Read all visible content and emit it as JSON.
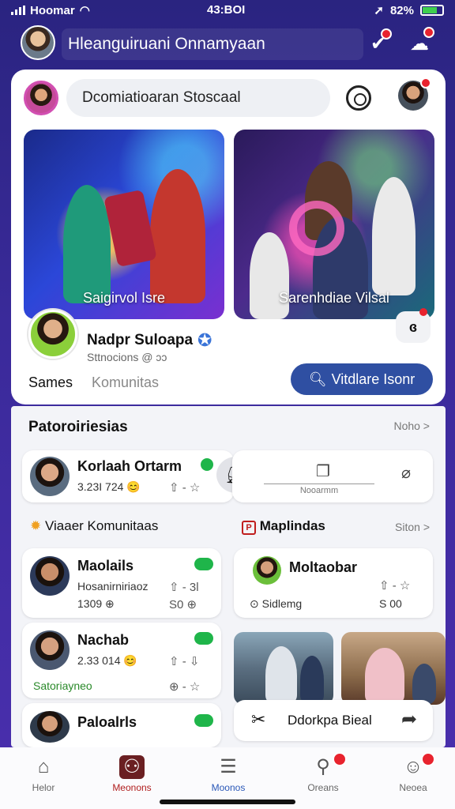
{
  "status_bar": {
    "carrier": "Hoomar",
    "time": "43:BOI",
    "battery": "82%"
  },
  "header": {
    "title": "Hleanguiruani Onnamyaan"
  },
  "search": {
    "placeholder": "Dcomiatioaran Stoscaal"
  },
  "banners": [
    {
      "label": "Saigirvol Isre"
    },
    {
      "label": "Sarenhdiae Vilsal"
    }
  ],
  "banner_corner_label": "ɞ",
  "group": {
    "name": "Nadpr Suloapa",
    "subtitle": "Sttnocions",
    "subtitle_suffix": "@ ɔɔ",
    "tabs": [
      "Sames",
      "Komunitas"
    ],
    "join_label": "Vitdlare Isonr"
  },
  "section": {
    "title": "Patoroiriesias",
    "link": "Noho >"
  },
  "featured_person": {
    "name": "Korlaah Ortarm",
    "meta": "3.23I 724 😊",
    "input_label": "Nooarmm"
  },
  "community_heading": "Viaaer Komunitaas",
  "mapl_heading": "Maplindas",
  "mapl_link": "Siton >",
  "community_cards": [
    {
      "name": "Maolails",
      "meta_top": "Hosanirniriaoz",
      "meta_bottom": "1309 ⊕",
      "icons_top": "⇧ - 3l",
      "icons_bottom": "S0 ⊕"
    },
    {
      "name": "Nachab",
      "meta_top": "2.33 014 😊",
      "meta_bottom": "Satoriayneo",
      "icons_top": "⇧ - ⇩",
      "icons_bottom": "⊕ - ☆"
    },
    {
      "name": "Paloalrls",
      "meta_top": "",
      "meta_bottom": "",
      "icons_top": "",
      "icons_bottom": ""
    }
  ],
  "mapl_card": {
    "name": "Moltaobar",
    "meta_left": "Sidlemg",
    "meta_right": "S 00",
    "icons_top": "⇧ - ☆"
  },
  "share_bar": {
    "label": "Ddorkpa Bieal"
  },
  "bottom_nav": [
    {
      "label": "Helor",
      "icon": "home-icon"
    },
    {
      "label": "Meonons",
      "icon": "game-icon"
    },
    {
      "label": "Moonos",
      "icon": "document-icon"
    },
    {
      "label": "Oreans",
      "icon": "people-icon"
    },
    {
      "label": "Neoea",
      "icon": "profile-icon"
    }
  ]
}
